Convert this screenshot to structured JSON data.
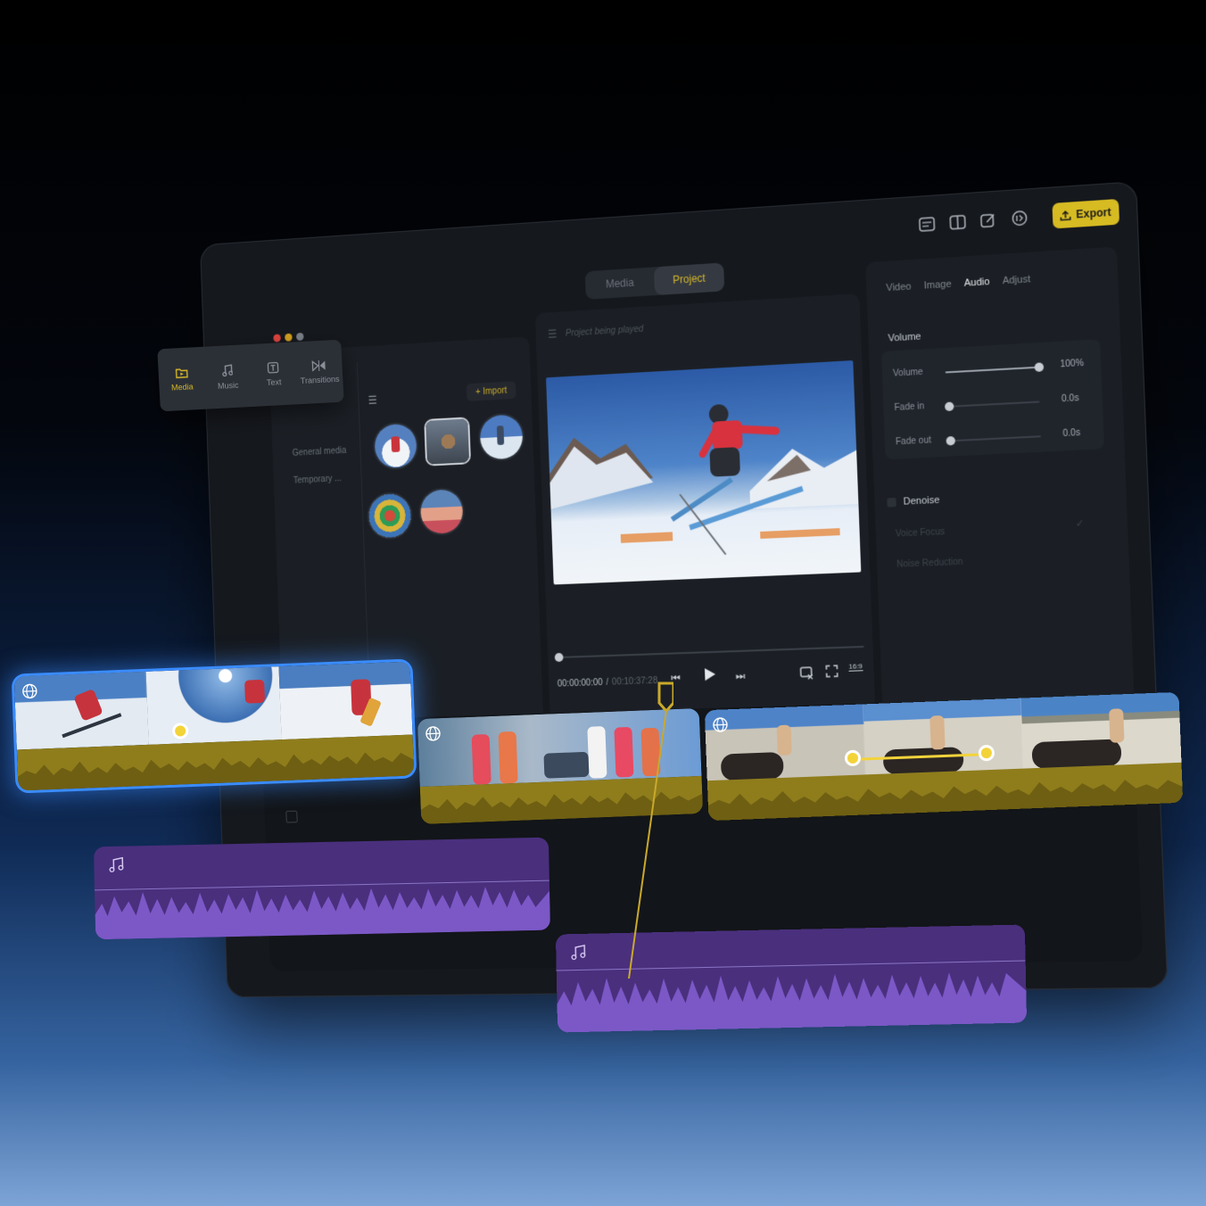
{
  "window": {
    "tabs": [
      {
        "label": "Media",
        "active": false
      },
      {
        "label": "Project",
        "active": true
      }
    ],
    "toolbar_icons": [
      "subtitle-icon",
      "layout-icon",
      "edit-icon",
      "speed-icon"
    ],
    "export_label": "Export",
    "accent_color": "#d7bb22"
  },
  "left_tabs": [
    {
      "label": "Media",
      "icon": "folder-icon",
      "active": true
    },
    {
      "label": "Music",
      "icon": "music-icon",
      "active": false
    },
    {
      "label": "Text",
      "icon": "text-icon",
      "active": false
    },
    {
      "label": "Transitions",
      "icon": "transitions-icon",
      "active": false
    }
  ],
  "media_panel": {
    "import_label": "Import",
    "categories": [
      "General media",
      "Temporary ..."
    ]
  },
  "preview": {
    "title": "Project being played",
    "current_time": "00:00:00:00",
    "separator": "/",
    "total_time": "00:10:37:28",
    "aspect_ratio": "16:9"
  },
  "inspector": {
    "tabs": [
      {
        "label": "Video",
        "active": false
      },
      {
        "label": "Image",
        "active": false
      },
      {
        "label": "Audio",
        "active": true
      },
      {
        "label": "Adjust",
        "active": false
      }
    ],
    "volume_section": "Volume",
    "sliders": [
      {
        "label": "Volume",
        "value": "100%",
        "level": 1.0
      },
      {
        "label": "Fade in",
        "value": "0.0s",
        "level": 0.0
      },
      {
        "label": "Fade out",
        "value": "0.0s",
        "level": 0.0
      }
    ],
    "denoise_label": "Denoise",
    "denoise_options": [
      "Voice Focus",
      "Noise Reduction"
    ]
  },
  "timeline": {
    "playhead_color": "#c9a92b",
    "selection_color": "#3a8cff",
    "audio_color": "#4a2f7d",
    "wave_color": "#7b58c6"
  }
}
